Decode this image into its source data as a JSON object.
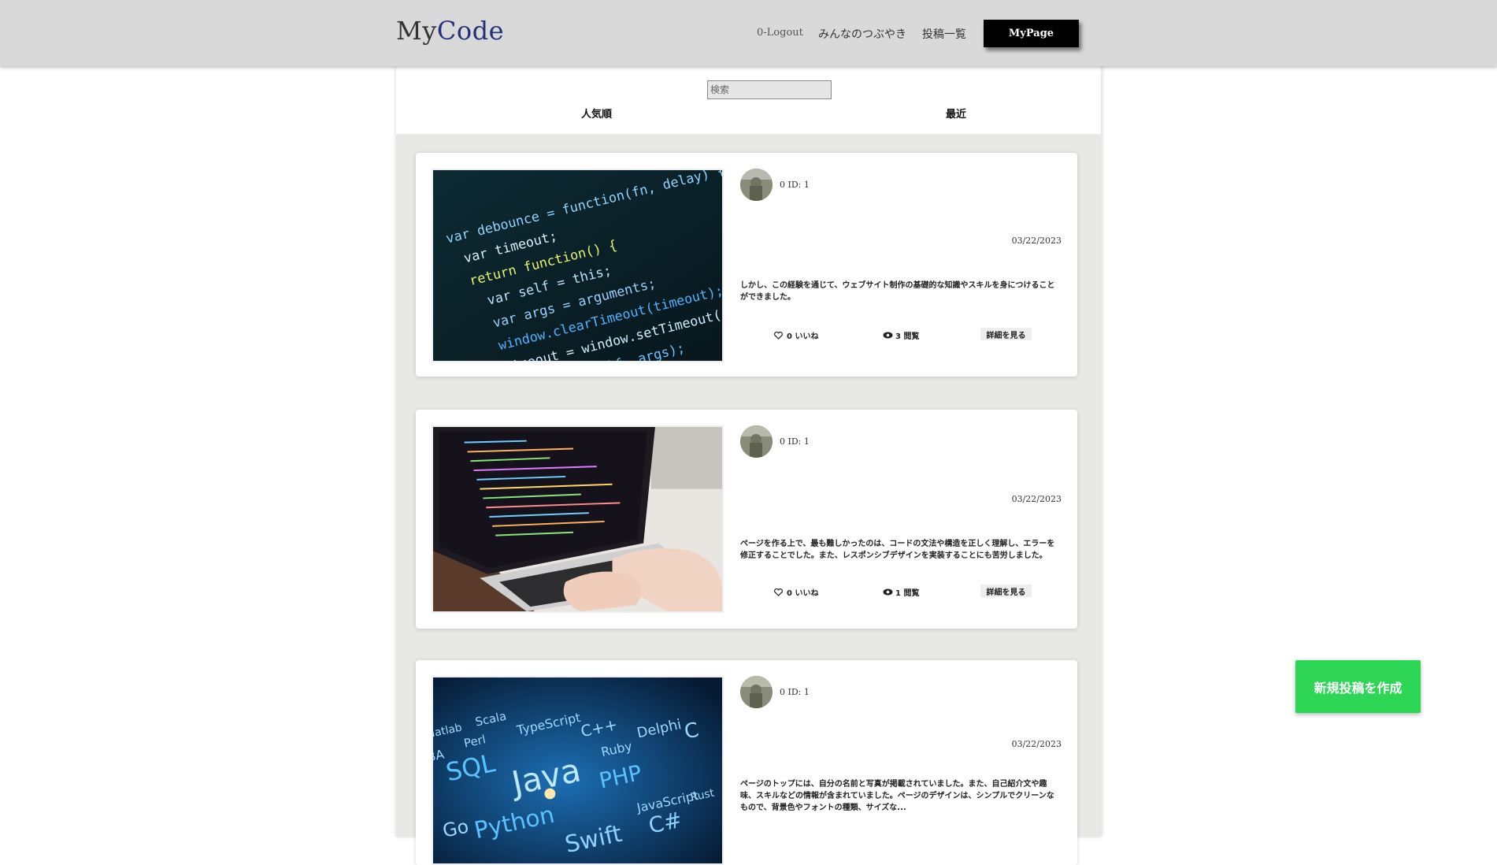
{
  "header": {
    "logo_my": "My",
    "logo_code": "Code",
    "nav_logout": "0-Logout",
    "nav_tweets": "みんなのつぶやき",
    "nav_posts": "投稿一覧",
    "mypage_label": "MyPage"
  },
  "search": {
    "placeholder": "検索"
  },
  "sort": {
    "popular": "人気順",
    "recent": "最近"
  },
  "posts": [
    {
      "user": "0 ID: 1",
      "date": "03/22/2023",
      "excerpt": "しかし、この経験を通じて、ウェブサイト制作の基礎的な知識やスキルを身につけることができました。",
      "likes": "0 いいね",
      "views": "3 閲覧",
      "detail": "詳細を見る",
      "image_subject": "code-editor-closeup"
    },
    {
      "user": "0 ID: 1",
      "date": "03/22/2023",
      "excerpt": "ページを作る上で、最も難しかったのは、コードの文法や構造を正しく理解し、エラーを修正することでした。また、レスポンシブデザインを実装することにも苦労しました。",
      "likes": "0 いいね",
      "views": "1 閲覧",
      "detail": "詳細を見る",
      "image_subject": "laptop-typing"
    },
    {
      "user": "0 ID: 1",
      "date": "03/22/2023",
      "excerpt": "ページのトップには、自分の名前と写真が掲載されていました。また、自己紹介文や趣味、スキルなどの情報が含まれていました。ページのデザインは、シンプルでクリーンなもので、背景色やフォントの種類、サイズな...",
      "image_subject": "programming-languages-word-cloud"
    }
  ],
  "code_lines": [
    "var debounce = function(fn, delay) {",
    "var timeout;",
    "return function() {",
    "var self = this;",
    "var args = arguments;",
    "window.clearTimeout(timeout);",
    "timeout = window.setTimeout(",
    "fn.apply(self, args);"
  ],
  "languages": [
    "Matlab",
    "Scala",
    "Perl",
    "TypeScript",
    "SQL",
    "Java",
    "Python",
    "PHP",
    "Swift",
    "C#",
    "C++",
    "Ruby",
    "Delphi",
    "JavaScript",
    "Go",
    "C",
    "BA",
    "Rust"
  ],
  "new_post_label": "新規投稿を作成",
  "colors": {
    "header_bg": "#d9d9d9",
    "logo_code": "#24307a",
    "mypage_bg": "#000000",
    "new_post_bg": "#2dd655",
    "column_bg": "#e8e8e4"
  }
}
